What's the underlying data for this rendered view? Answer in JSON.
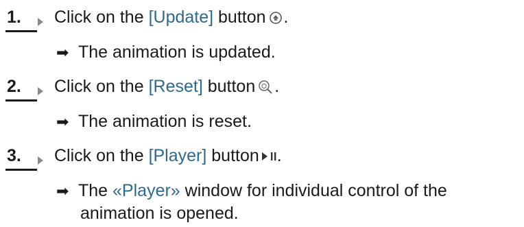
{
  "steps": [
    {
      "number": "1.",
      "prefix": "Click on the ",
      "term": "[Update]",
      "suffix_before_icon": " button",
      "suffix_after_icon": ".",
      "icon": "update-icon",
      "result": "The animation is updated."
    },
    {
      "number": "2.",
      "prefix": "Click on the ",
      "term": "[Reset]",
      "suffix_before_icon": " button",
      "suffix_after_icon": ".",
      "icon": "reset-icon",
      "result": "The animation is reset."
    },
    {
      "number": "3.",
      "prefix": "Click on the ",
      "term": "[Player]",
      "suffix_before_icon": " button",
      "suffix_after_icon": ".",
      "icon": "player-icon",
      "result_line1_prefix": "The ",
      "result_line1_term": "«Player»",
      "result_line1_rest": " window for individual control of the",
      "result_line2": "animation is opened."
    }
  ],
  "colors": {
    "text": "#1a1a1a",
    "ui_term": "#2e6a8a",
    "step_arrow": "#8a8a8a"
  }
}
